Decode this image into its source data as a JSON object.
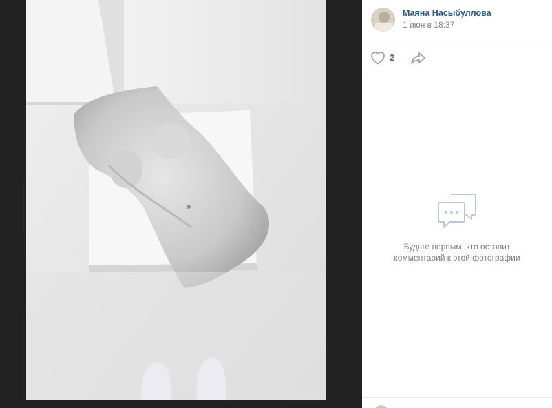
{
  "author": {
    "name": "Маяна Насыбуллова",
    "date": "1 июн в 18:37"
  },
  "actions": {
    "likes": "2",
    "like_icon": "heart-icon",
    "share_icon": "share-arrow-icon"
  },
  "comments": {
    "empty_line1": "Будьте первым, кто оставит",
    "empty_line2": "комментарий к этой фотографии",
    "icon": "comment-bubble-icon"
  },
  "colors": {
    "viewer_bg": "#222222",
    "link": "#2a5885",
    "muted": "#828282"
  }
}
